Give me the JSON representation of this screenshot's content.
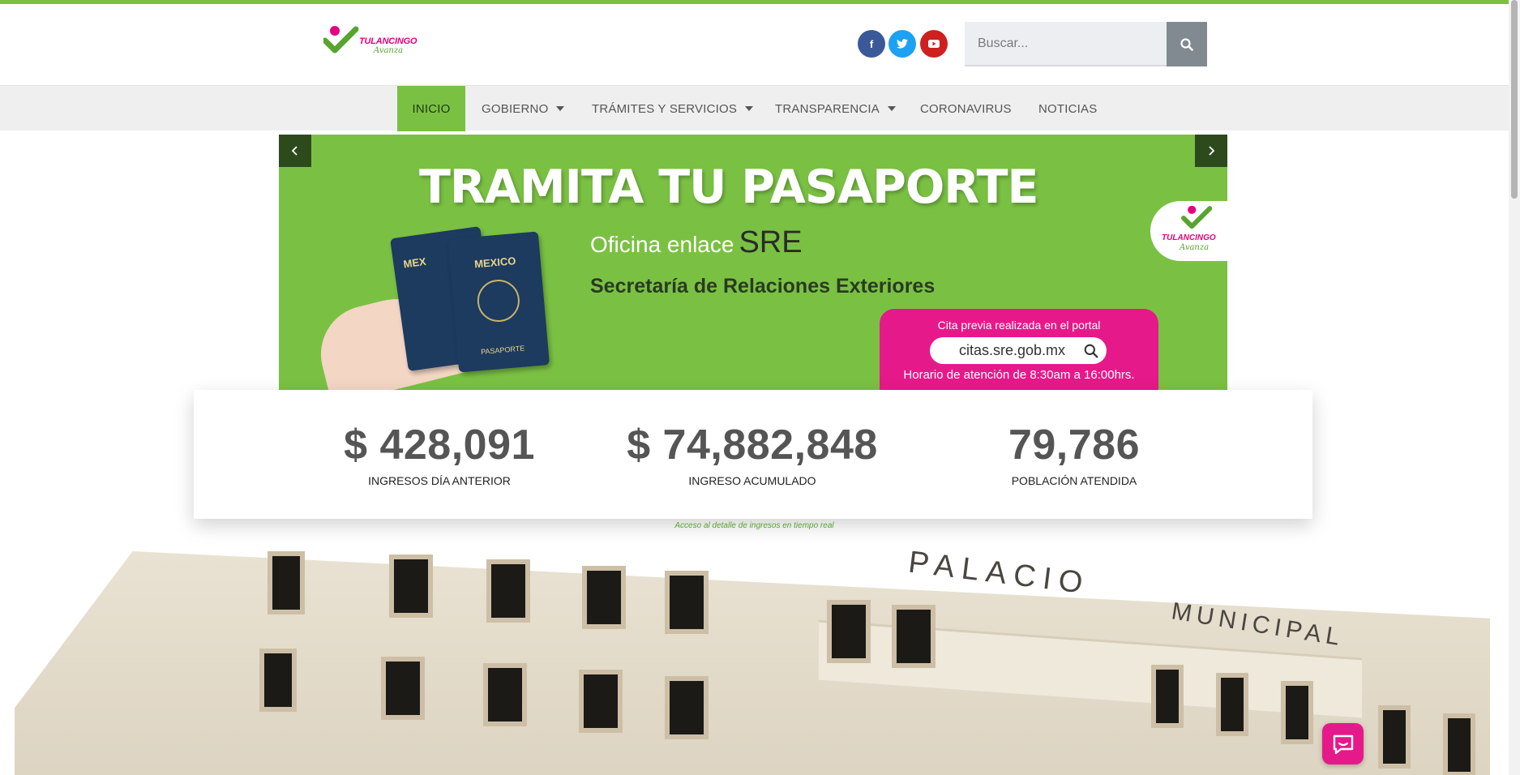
{
  "header": {
    "logo_text": "TULANCINGO",
    "logo_sub": "Avanza",
    "social": [
      {
        "name": "facebook",
        "glyph": "f"
      },
      {
        "name": "twitter",
        "glyph": "t"
      },
      {
        "name": "youtube",
        "glyph": "▶"
      }
    ],
    "search": {
      "placeholder": "Buscar...",
      "value": ""
    }
  },
  "nav": {
    "items": [
      {
        "label": "INICIO",
        "active": true,
        "dropdown": false
      },
      {
        "label": "GOBIERNO",
        "active": false,
        "dropdown": true
      },
      {
        "label": "TRÁMITES Y SERVICIOS",
        "active": false,
        "dropdown": true
      },
      {
        "label": "TRANSPARENCIA",
        "active": false,
        "dropdown": true
      },
      {
        "label": "CORONAVIRUS",
        "active": false,
        "dropdown": false
      },
      {
        "label": "NOTICIAS",
        "active": false,
        "dropdown": false
      }
    ]
  },
  "slider": {
    "title": "TRAMITA TU PASAPORTE",
    "line1": "Oficina enlace",
    "line1_bold": "SRE",
    "line2": "Secretaría de Relaciones Exteriores",
    "box_top": "Cita previa realizada en el portal",
    "box_url": "citas.sre.gob.mx",
    "box_bottom": "Horario de atención de 8:30am a 16:00hrs.",
    "passport_title": "MEXICO",
    "passport_title_back": "MEX",
    "passport_foot": "PASAPORTE",
    "badge_text": "TULANCINGO",
    "badge_sub": "Avanza"
  },
  "stats": [
    {
      "value": "$ 428,091",
      "label": "INGRESOS DÍA ANTERIOR"
    },
    {
      "value": "$ 74,882,848",
      "label": "INGRESO ACUMULADO"
    },
    {
      "value": "79,786",
      "label": "POBLACIÓN ATENDIDA"
    }
  ],
  "detail_link": "Acceso al detalle de ingresos en tiempo real",
  "building": {
    "sign1": "PALACIO",
    "sign2": "MUNICIPAL"
  },
  "colors": {
    "brand_green": "#7ac143",
    "brand_pink": "#e6198a",
    "dark_green": "#2d4a1d"
  }
}
